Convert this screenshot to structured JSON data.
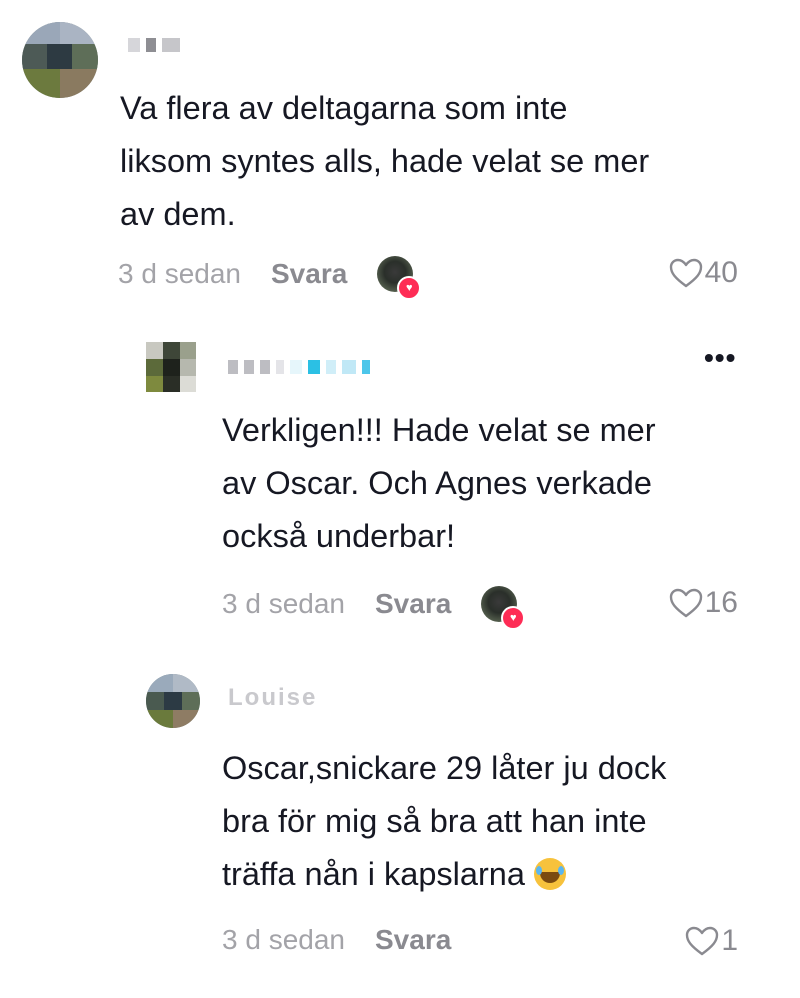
{
  "comments": [
    {
      "username": "",
      "text_lines": [
        "Va flera av deltagarna som inte",
        "liksom syntes alls, hade velat se mer",
        "av dem."
      ],
      "time": "3 d sedan",
      "reply": "Svara",
      "likes": "40",
      "creator_liked": true
    },
    {
      "username": "",
      "text_lines": [
        "Verkligen!!! Hade velat se mer",
        "av Oscar. Och Agnes verkade",
        "också underbar!"
      ],
      "time": "3 d sedan",
      "reply": "Svara",
      "likes": "16",
      "creator_liked": true,
      "more": "•••"
    },
    {
      "username": "Louise",
      "text_lines": [
        "Oscar,snickare 29 låter ju dock",
        "bra för mig så bra att han inte",
        "träffa nån i kapslarna"
      ],
      "emoji": "face-with-tears-of-joy",
      "time": "3 d sedan",
      "reply": "Svara",
      "likes": "1",
      "creator_liked": false
    }
  ],
  "colors": {
    "heart_badge": "#fe2c55",
    "meta": "#a3a3a8",
    "text": "#161823"
  }
}
